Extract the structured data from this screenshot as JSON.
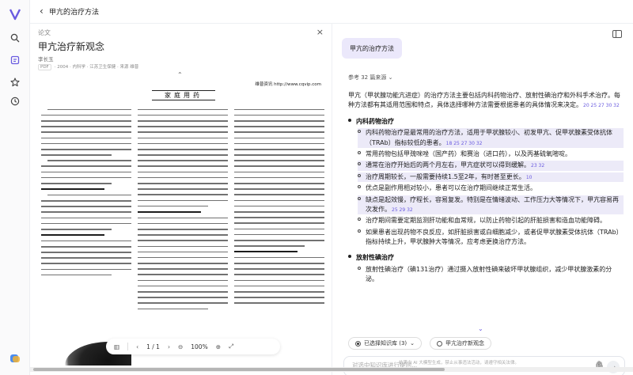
{
  "header": {
    "back_icon": "chevron-left-icon",
    "title": "甲亢的治疗方法"
  },
  "rail": {
    "icons": [
      "app-logo-icon",
      "search-icon",
      "library-icon",
      "star-icon",
      "history-icon"
    ]
  },
  "document": {
    "type_label": "论文",
    "title": "甲亢治疗新观念",
    "author": "李长玉",
    "meta_badge": "PDF",
    "meta_text": "· 2004 · 内科学 · 江苏卫生保健 · 来源 维普",
    "scan": {
      "url_text": "维普资讯 http://www.cqvip.com",
      "section": "家庭用药",
      "article_title": "甲亢治疗新观念"
    },
    "toolbar": {
      "page": "1",
      "total": "1",
      "zoom": "100%"
    }
  },
  "chat": {
    "question": "甲亢的治疗方法",
    "refs_label": "参考 32 篇来源",
    "intro": "甲亢（甲状腺功能亢进症）的治疗方法主要包括内科药物治疗、放射性碘治疗和外科手术治疗。每种方法都有其适用范围和特点，具体选择哪种方法需要根据患者的具体情况来决定。",
    "intro_cites": "20 25 27 30 32",
    "sections": [
      {
        "title": "内科药物治疗",
        "items": [
          {
            "text": "内科药物治疗是最常用的治疗方法，适用于甲状腺较小、初发甲亢、促甲状腺素受体抗体（TRAb）指标较低的患者。",
            "cites": "18 25 27 30 32",
            "highlight": true
          },
          {
            "text": "常用药物包括甲巯咪唑（国产药）和赛治（进口药），以及丙基硫氧嘧啶。",
            "cites": "",
            "highlight": false
          },
          {
            "text": "通常在治疗开始后的两个月左右，甲亢症状可以得到缓解。",
            "cites": "23 32",
            "highlight": true
          },
          {
            "text": "治疗周期较长，一般需要持续1.5至2年，有时甚至更长。",
            "cites": "10",
            "highlight": true
          },
          {
            "text": "优点是副作用相对较小，患者可以在治疗期间继续正常生活。",
            "cites": "",
            "highlight": false
          },
          {
            "text": "缺点是起效慢，疗程长，容易复发。特别是在情绪波动、工作压力大等情况下，甲亢容易再次发作。",
            "cites": "25 29 32",
            "highlight": true
          },
          {
            "text": "治疗期间需要定期监测肝功能和血常规，以防止药物引起的肝脏损害和造血功能障碍。",
            "cites": "",
            "highlight": false
          },
          {
            "text": "如果患者出现药物不良反应，如肝脏损害或白细胞减少，或者促甲状腺素受体抗体（TRAb）指标持续上升，甲状腺肿大等情况，应考虑更换治疗方法。",
            "cites": "",
            "highlight": false
          }
        ]
      },
      {
        "title": "放射性碘治疗",
        "items": [
          {
            "text": "放射性碘治疗（碘131治疗）通过摄入放射性碘来破坏甲状腺组织，减少甲状腺激素的分泌。",
            "cites": "",
            "highlight": false
          }
        ]
      }
    ],
    "scope": {
      "selected": "已选择知识库 (3)",
      "other": "甲亢治疗新观念"
    },
    "input_placeholder": "对选中知识库进行提问...",
    "disclaimer": "结果由 AI 大模型生成，禁止从事违法活动，请遵守相关法律。"
  }
}
